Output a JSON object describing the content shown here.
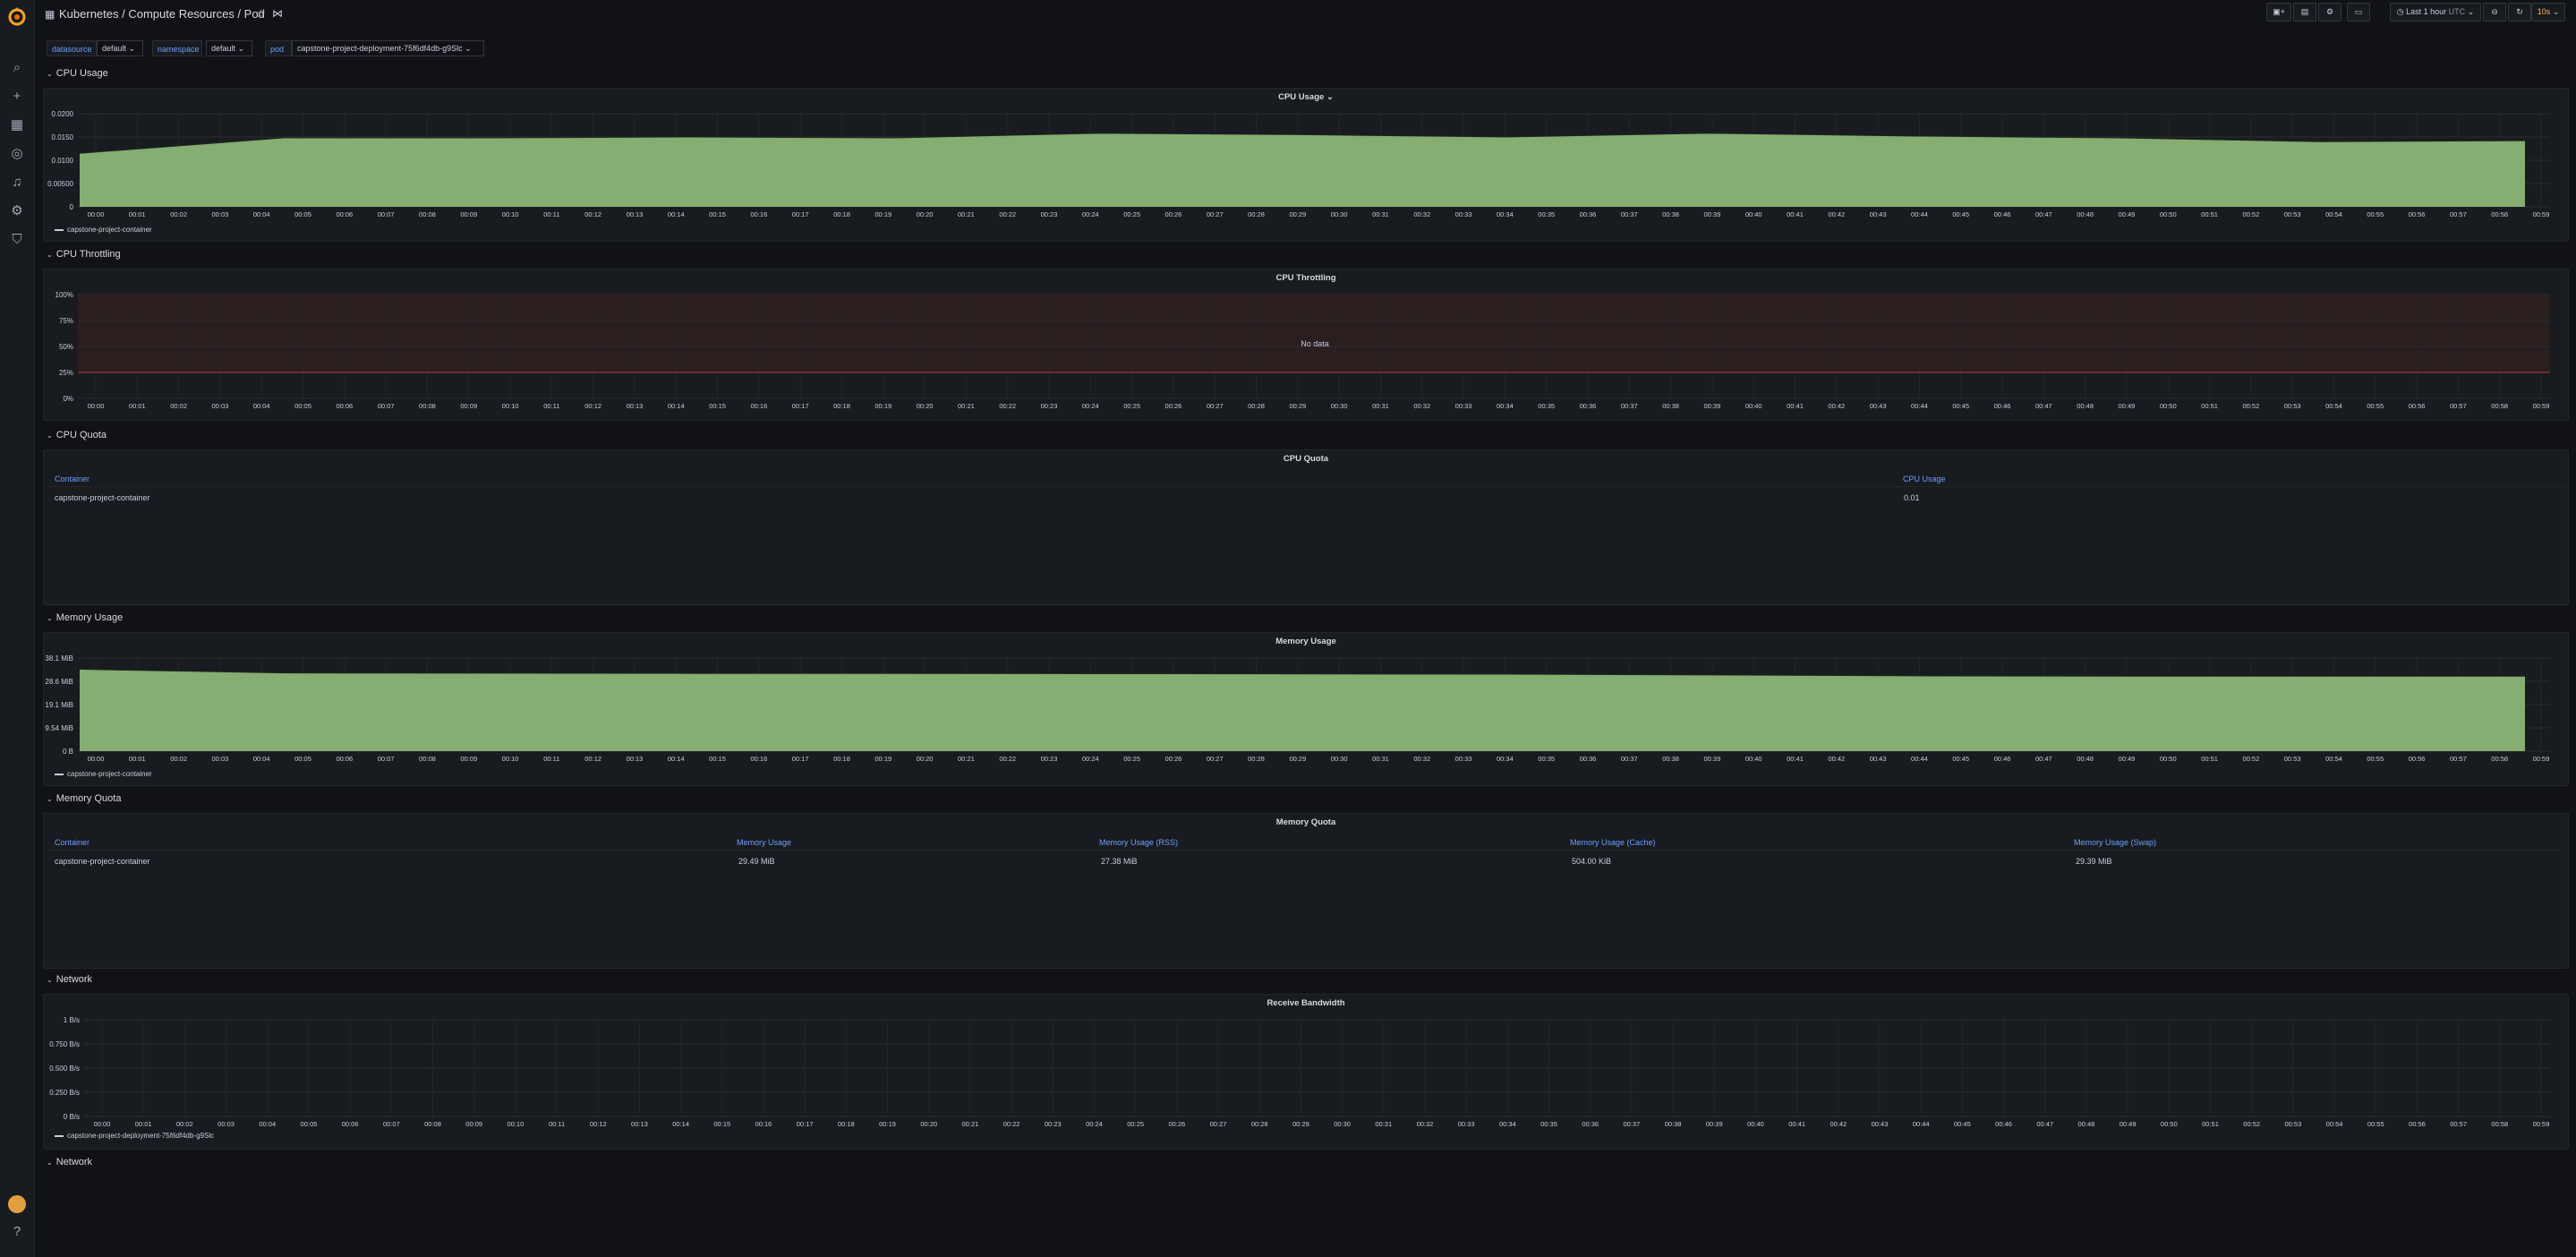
{
  "header": {
    "title": "Kubernetes / Compute Resources / Pod",
    "time_range": "Last 1 hour",
    "timezone": "UTC",
    "refresh": "10s"
  },
  "variables": [
    {
      "label": "datasource",
      "value": "default"
    },
    {
      "label": "namespace",
      "value": "default"
    },
    {
      "label": "pod",
      "value": "capstone-project-deployment-75f6df4db-g9Slc"
    }
  ],
  "rows": {
    "cpu_usage": "CPU Usage",
    "cpu_throttling": "CPU Throttling",
    "cpu_quota": "CPU Quota",
    "memory_usage": "Memory Usage",
    "memory_quota": "Memory Quota",
    "network1": "Network",
    "network2": "Network"
  },
  "time_ticks": [
    "00:00",
    "00:01",
    "00:02",
    "00:03",
    "00:04",
    "00:05",
    "00:06",
    "00:07",
    "00:08",
    "00:09",
    "00:10",
    "00:11",
    "00:12",
    "00:13",
    "00:14",
    "00:15",
    "00:16",
    "00:17",
    "00:18",
    "00:19",
    "00:20",
    "00:21",
    "00:22",
    "00:23",
    "00:24",
    "00:25",
    "00:26",
    "00:27",
    "00:28",
    "00:29",
    "00:30",
    "00:31",
    "00:32",
    "00:33",
    "00:34",
    "00:35",
    "00:36",
    "00:37",
    "00:38",
    "00:39",
    "00:40",
    "00:41",
    "00:42",
    "00:43",
    "00:44",
    "00:45",
    "00:46",
    "00:47",
    "00:48",
    "00:49",
    "00:50",
    "00:51",
    "00:52",
    "00:53",
    "00:54",
    "00:55",
    "00:56",
    "00:57",
    "00:58",
    "00:59"
  ],
  "panels": {
    "cpu_usage": {
      "title": "CPU Usage",
      "title_suffix": "⌄",
      "y_ticks": [
        "0.0200",
        "0.0150",
        "0.0100",
        "0.00500",
        "0"
      ],
      "ylim": [
        0,
        0.02
      ],
      "legend": "capstone-project-container",
      "color": "#73bf69"
    },
    "cpu_throttling": {
      "title": "CPU Throttling",
      "y_ticks": [
        "100%",
        "75%",
        "50%",
        "25%",
        "0%"
      ],
      "no_data": "No data"
    },
    "cpu_quota": {
      "title": "CPU Quota",
      "columns": [
        "Container",
        "CPU Usage"
      ],
      "rows": [
        [
          "capstone-project-container",
          "0.01"
        ]
      ]
    },
    "memory_usage": {
      "title": "Memory Usage",
      "y_ticks": [
        "38.1 MiB",
        "28.6 MiB",
        "19.1 MiB",
        "9.54 MiB",
        "0 B"
      ],
      "ylim_mib": [
        0,
        38.1
      ],
      "legend": "capstone-project-container",
      "color": "#73bf69"
    },
    "memory_quota": {
      "title": "Memory Quota",
      "columns": [
        "Container",
        "Memory Usage",
        "Memory Usage (RSS)",
        "Memory Usage (Cache)",
        "Memory Usage (Swap)"
      ],
      "rows": [
        [
          "capstone-project-container",
          "29.49 MiB",
          "27.38 MiB",
          "504.00 KiB",
          "29.39 MiB"
        ]
      ]
    },
    "receive_bandwidth": {
      "title": "Receive Bandwidth",
      "y_ticks": [
        "1 B/s",
        "0.750 B/s",
        "0.500 B/s",
        "0.250 B/s",
        "0 B/s"
      ],
      "legend": "capstone-project-deployment-75f6df4db-g9Slc"
    }
  },
  "chart_data": [
    {
      "type": "area",
      "title": "CPU Usage",
      "x": [
        "00:00",
        "00:05",
        "00:10",
        "00:15",
        "00:20",
        "00:25",
        "00:30",
        "00:35",
        "00:40",
        "00:45",
        "00:50",
        "00:55",
        "00:59"
      ],
      "series": [
        {
          "name": "capstone-project-container",
          "values": [
            0.0115,
            0.0148,
            0.0148,
            0.015,
            0.0148,
            0.0158,
            0.0155,
            0.015,
            0.0158,
            0.0152,
            0.0148,
            0.014,
            0.0142
          ]
        }
      ],
      "ylim": [
        0,
        0.02
      ]
    },
    {
      "type": "area",
      "title": "Memory Usage",
      "x": [
        "00:00",
        "00:05",
        "00:10",
        "00:15",
        "00:20",
        "00:25",
        "00:30",
        "00:35",
        "00:40",
        "00:45",
        "00:50",
        "00:55",
        "00:59"
      ],
      "series": [
        {
          "name": "capstone-project-container",
          "values": [
            33.5,
            32.0,
            31.9,
            31.8,
            31.8,
            31.7,
            31.6,
            31.5,
            31.2,
            30.8,
            30.7,
            30.7,
            30.7
          ]
        }
      ],
      "ylim": [
        0,
        38.1
      ]
    }
  ]
}
